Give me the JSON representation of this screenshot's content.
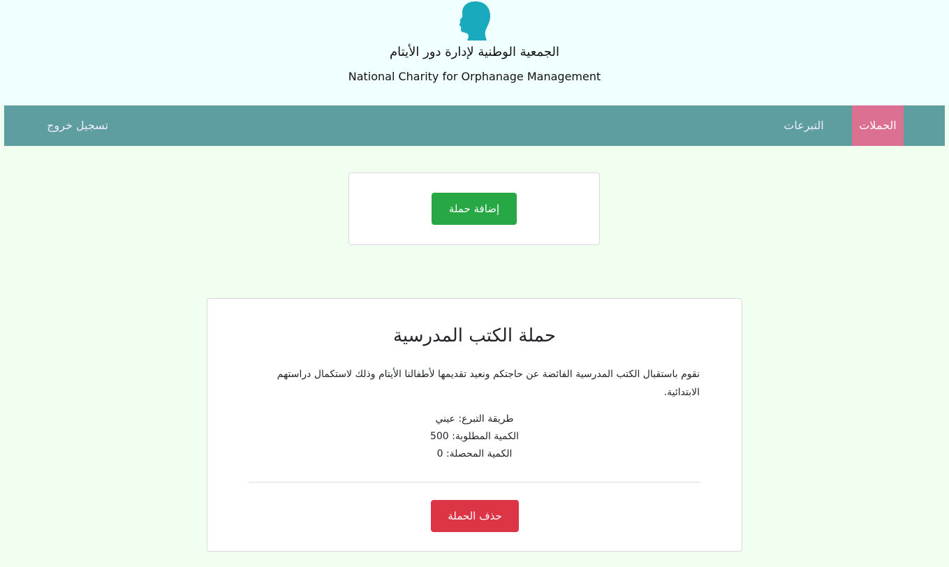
{
  "header": {
    "logo_icon": "child-head-silhouette-icon",
    "logo_color": "#1aaabd",
    "org_name_ar": "الجمعية الوطنية لإدارة دور الأيتام",
    "org_name_en": "National Charity for Orphanage Management"
  },
  "nav": {
    "campaigns": "الحملات",
    "donations": "التبرعات",
    "logout": "تسجيل خروج"
  },
  "add_card": {
    "add_button": "إضافة حملة"
  },
  "campaign": {
    "title": "حملة الكتب المدرسية",
    "description": "نقوم باستقبال الكتب المدرسية الفائضة عن حاجتكم ونعيد تقديمها لأطفالنا الأيتام وذلك لاستكمال دراستهم الابتدائية.",
    "donation_method": "طريقة التبرع: عيني",
    "required_quantity": "الكمية المطلوبة: 500",
    "collected_quantity": "الكمية المحصلة: 0",
    "delete_button": "حذف الحملة"
  },
  "colors": {
    "header_bg": "#f0ffff",
    "page_bg": "#f0fff0",
    "navbar_bg": "#5f9ea0",
    "active_tab": "#db7093",
    "add_button": "#28a745",
    "delete_button": "#dc3545"
  }
}
